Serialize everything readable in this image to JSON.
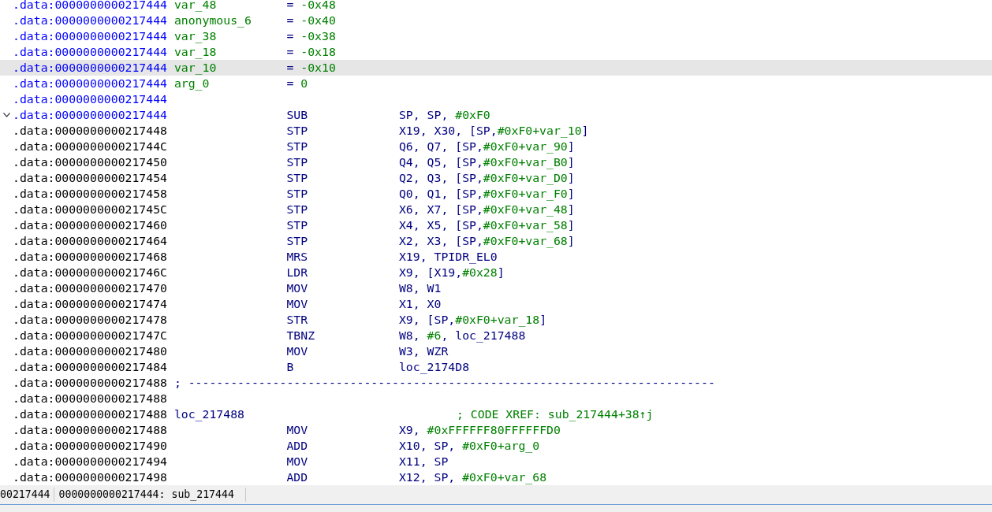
{
  "listing": {
    "rows": [
      {
        "kind": "stackvar",
        "address": ".data:0000000000217444",
        "color": "#0000ff",
        "selected": false,
        "name": "var_48",
        "eq": "=",
        "value": "-0x48"
      },
      {
        "kind": "stackvar",
        "address": ".data:0000000000217444",
        "color": "#0000ff",
        "selected": false,
        "name": "anonymous_6",
        "eq": "=",
        "value": "-0x40"
      },
      {
        "kind": "stackvar",
        "address": ".data:0000000000217444",
        "color": "#0000ff",
        "selected": false,
        "name": "var_38",
        "eq": "=",
        "value": "-0x38"
      },
      {
        "kind": "stackvar",
        "address": ".data:0000000000217444",
        "color": "#0000ff",
        "selected": false,
        "name": "var_18",
        "eq": "=",
        "value": "-0x18"
      },
      {
        "kind": "stackvar",
        "address": ".data:0000000000217444",
        "color": "#0000ff",
        "selected": true,
        "name": "var_10",
        "eq": "=",
        "value": "-0x10"
      },
      {
        "kind": "stackvar",
        "address": ".data:0000000000217444",
        "color": "#0000ff",
        "selected": false,
        "name": "arg_0",
        "eq": "=",
        "value": "0"
      },
      {
        "kind": "blank",
        "address": ".data:0000000000217444",
        "color": "#0000ff",
        "selected": false
      },
      {
        "kind": "insn",
        "address": ".data:0000000000217444",
        "color": "#0000ff",
        "selected": false,
        "collapsible": true,
        "mnemonic": "SUB",
        "operands": [
          {
            "text": "SP, SP, ",
            "kind": "reg"
          },
          {
            "text": "#0xF0",
            "kind": "imm"
          }
        ]
      },
      {
        "kind": "insn",
        "address": ".data:0000000000217448",
        "color": "#000000",
        "selected": false,
        "mnemonic": "STP",
        "operands": [
          {
            "text": "X19, X30, [SP,",
            "kind": "reg"
          },
          {
            "text": "#0xF0+var_10",
            "kind": "imm"
          },
          {
            "text": "]",
            "kind": "reg"
          }
        ]
      },
      {
        "kind": "insn",
        "address": ".data:000000000021744C",
        "color": "#000000",
        "selected": false,
        "mnemonic": "STP",
        "operands": [
          {
            "text": "Q6, Q7, [SP,",
            "kind": "reg"
          },
          {
            "text": "#0xF0+var_90",
            "kind": "imm"
          },
          {
            "text": "]",
            "kind": "reg"
          }
        ]
      },
      {
        "kind": "insn",
        "address": ".data:0000000000217450",
        "color": "#000000",
        "selected": false,
        "mnemonic": "STP",
        "operands": [
          {
            "text": "Q4, Q5, [SP,",
            "kind": "reg"
          },
          {
            "text": "#0xF0+var_B0",
            "kind": "imm"
          },
          {
            "text": "]",
            "kind": "reg"
          }
        ]
      },
      {
        "kind": "insn",
        "address": ".data:0000000000217454",
        "color": "#000000",
        "selected": false,
        "mnemonic": "STP",
        "operands": [
          {
            "text": "Q2, Q3, [SP,",
            "kind": "reg"
          },
          {
            "text": "#0xF0+var_D0",
            "kind": "imm"
          },
          {
            "text": "]",
            "kind": "reg"
          }
        ]
      },
      {
        "kind": "insn",
        "address": ".data:0000000000217458",
        "color": "#000000",
        "selected": false,
        "mnemonic": "STP",
        "operands": [
          {
            "text": "Q0, Q1, [SP,",
            "kind": "reg"
          },
          {
            "text": "#0xF0+var_F0",
            "kind": "imm"
          },
          {
            "text": "]",
            "kind": "reg"
          }
        ]
      },
      {
        "kind": "insn",
        "address": ".data:000000000021745C",
        "color": "#000000",
        "selected": false,
        "mnemonic": "STP",
        "operands": [
          {
            "text": "X6, X7, [SP,",
            "kind": "reg"
          },
          {
            "text": "#0xF0+var_48",
            "kind": "imm"
          },
          {
            "text": "]",
            "kind": "reg"
          }
        ]
      },
      {
        "kind": "insn",
        "address": ".data:0000000000217460",
        "color": "#000000",
        "selected": false,
        "mnemonic": "STP",
        "operands": [
          {
            "text": "X4, X5, [SP,",
            "kind": "reg"
          },
          {
            "text": "#0xF0+var_58",
            "kind": "imm"
          },
          {
            "text": "]",
            "kind": "reg"
          }
        ]
      },
      {
        "kind": "insn",
        "address": ".data:0000000000217464",
        "color": "#000000",
        "selected": false,
        "mnemonic": "STP",
        "operands": [
          {
            "text": "X2, X3, [SP,",
            "kind": "reg"
          },
          {
            "text": "#0xF0+var_68",
            "kind": "imm"
          },
          {
            "text": "]",
            "kind": "reg"
          }
        ]
      },
      {
        "kind": "insn",
        "address": ".data:0000000000217468",
        "color": "#000000",
        "selected": false,
        "mnemonic": "MRS",
        "operands": [
          {
            "text": "X19, TPIDR_EL0",
            "kind": "reg"
          }
        ]
      },
      {
        "kind": "insn",
        "address": ".data:000000000021746C",
        "color": "#000000",
        "selected": false,
        "mnemonic": "LDR",
        "operands": [
          {
            "text": "X9, [X19,",
            "kind": "reg"
          },
          {
            "text": "#0x28",
            "kind": "imm"
          },
          {
            "text": "]",
            "kind": "reg"
          }
        ]
      },
      {
        "kind": "insn",
        "address": ".data:0000000000217470",
        "color": "#000000",
        "selected": false,
        "mnemonic": "MOV",
        "operands": [
          {
            "text": "W8, W1",
            "kind": "reg"
          }
        ]
      },
      {
        "kind": "insn",
        "address": ".data:0000000000217474",
        "color": "#000000",
        "selected": false,
        "mnemonic": "MOV",
        "operands": [
          {
            "text": "X1, X0",
            "kind": "reg"
          }
        ]
      },
      {
        "kind": "insn",
        "address": ".data:0000000000217478",
        "color": "#000000",
        "selected": false,
        "mnemonic": "STR",
        "operands": [
          {
            "text": "X9, [SP,",
            "kind": "reg"
          },
          {
            "text": "#0xF0+var_18",
            "kind": "imm"
          },
          {
            "text": "]",
            "kind": "reg"
          }
        ]
      },
      {
        "kind": "insn",
        "address": ".data:000000000021747C",
        "color": "#000000",
        "selected": false,
        "mnemonic": "TBNZ",
        "operands": [
          {
            "text": "W8, ",
            "kind": "reg"
          },
          {
            "text": "#6",
            "kind": "imm"
          },
          {
            "text": ", loc_217488",
            "kind": "reg"
          }
        ]
      },
      {
        "kind": "insn",
        "address": ".data:0000000000217480",
        "color": "#000000",
        "selected": false,
        "mnemonic": "MOV",
        "operands": [
          {
            "text": "W3, WZR",
            "kind": "reg"
          }
        ]
      },
      {
        "kind": "insn",
        "address": ".data:0000000000217484",
        "color": "#000000",
        "selected": false,
        "mnemonic": "B",
        "operands": [
          {
            "text": "loc_2174D8",
            "kind": "reg"
          }
        ]
      },
      {
        "kind": "separator",
        "address": ".data:0000000000217488",
        "color": "#000000",
        "selected": false,
        "text": "; ---------------------------------------------------------------------------"
      },
      {
        "kind": "blank",
        "address": ".data:0000000000217488",
        "color": "#000000",
        "selected": false
      },
      {
        "kind": "label",
        "address": ".data:0000000000217488",
        "color": "#000000",
        "selected": false,
        "label": "loc_217488",
        "comment": "; CODE XREF: sub_217444+38↑j"
      },
      {
        "kind": "insn",
        "address": ".data:0000000000217488",
        "color": "#000000",
        "selected": false,
        "mnemonic": "MOV",
        "operands": [
          {
            "text": "X9, ",
            "kind": "reg"
          },
          {
            "text": "#0xFFFFFF80FFFFFFD0",
            "kind": "imm"
          }
        ]
      },
      {
        "kind": "insn",
        "address": ".data:0000000000217490",
        "color": "#000000",
        "selected": false,
        "mnemonic": "ADD",
        "operands": [
          {
            "text": "X10, SP, ",
            "kind": "reg"
          },
          {
            "text": "#0xF0+arg_0",
            "kind": "imm"
          }
        ]
      },
      {
        "kind": "insn",
        "address": ".data:0000000000217494",
        "color": "#000000",
        "selected": false,
        "mnemonic": "MOV",
        "operands": [
          {
            "text": "X11, SP",
            "kind": "reg"
          }
        ]
      },
      {
        "kind": "insn",
        "address": ".data:0000000000217498",
        "color": "#000000",
        "selected": false,
        "mnemonic": "ADD",
        "operands": [
          {
            "text": "X12, SP, ",
            "kind": "reg"
          },
          {
            "text": "#0xF0+var_68",
            "kind": "imm"
          }
        ]
      }
    ]
  },
  "status_bar": {
    "cells": [
      "00217444",
      "0000000000217444: sub_217444"
    ]
  }
}
